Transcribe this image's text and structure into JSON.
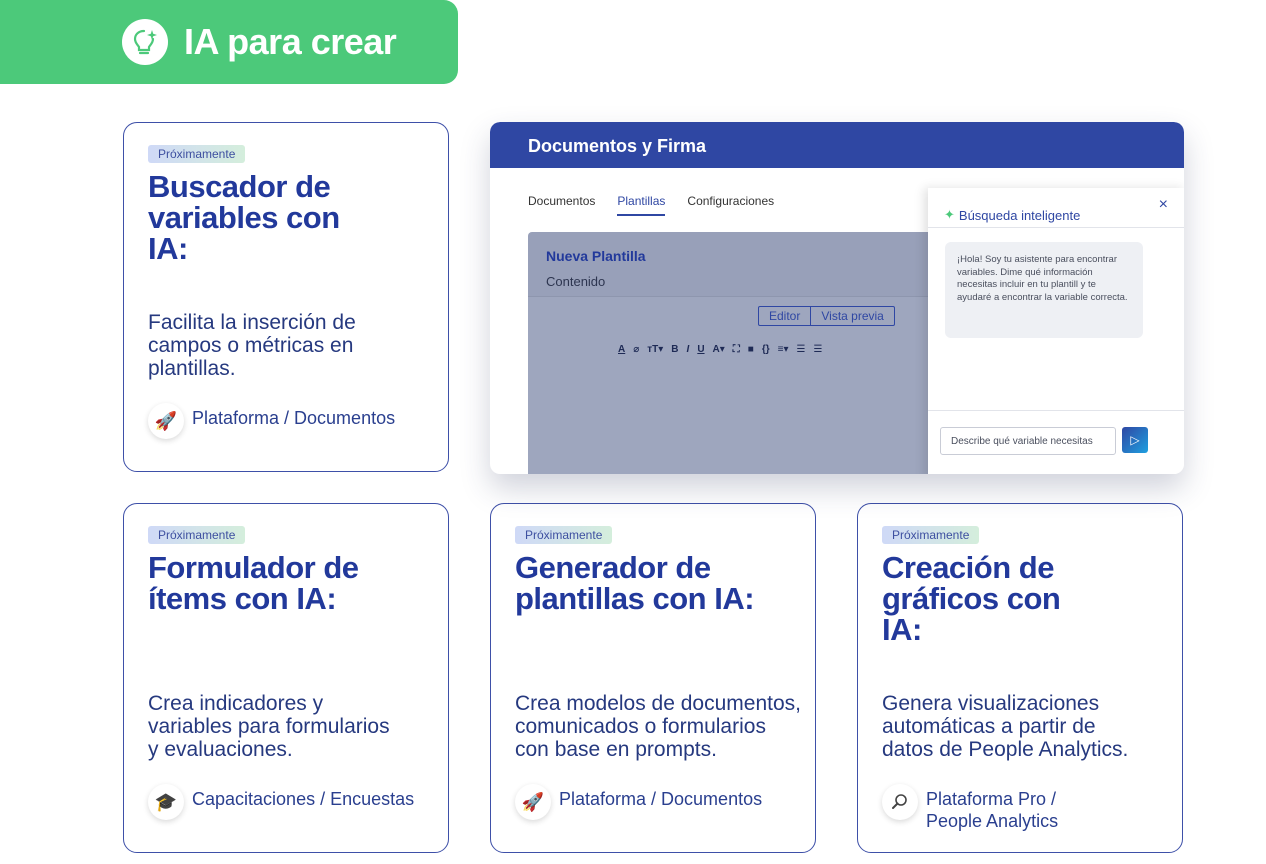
{
  "banner": {
    "title": "IA para crear",
    "icon": "lightbulb-sparkle-icon"
  },
  "badge_label": "Próximamente",
  "cards": [
    {
      "title": "Buscador de variables con IA:",
      "description": "Facilita la inserción de campos o métricas en plantillas.",
      "footer": "Plataforma / Documentos",
      "icon": "rocket-icon"
    },
    {
      "title": "Formulador de ítems con IA:",
      "description": "Crea indicadores y variables para formularios y evaluaciones.",
      "footer": "Capacitaciones / Encuestas",
      "icon": "graduation-cap-icon"
    },
    {
      "title": "Generador de plantillas con IA:",
      "description": "Crea modelos de documentos, comunicados o formularios con base en prompts.",
      "footer": "Plataforma / Documentos",
      "icon": "rocket-icon"
    },
    {
      "title": "Creación de gráficos con IA:",
      "description": "Genera visualizaciones automáticas a partir de datos de People Analytics.",
      "footer_line1": "Plataforma Pro /",
      "footer_line2": "People Analytics",
      "icon": "magnifier-icon"
    }
  ],
  "mock": {
    "header": "Documentos y Firma",
    "tabs": [
      "Documentos",
      "Plantillas",
      "Configuraciones"
    ],
    "active_tab": "Plantillas",
    "editor_title": "Nueva Plantilla",
    "editor_label": "Contenido",
    "mode_editor": "Editor",
    "mode_preview": "Vista previa",
    "chat_title": "Búsqueda inteligente",
    "chat_close": "×",
    "chat_message": "¡Hola! Soy tu asistente para encontrar variables. Dime qué información necesitas incluir en tu plantill y te ayudaré a encontrar la variable correcta.",
    "chat_placeholder": "Describe qué variable necesitas"
  },
  "colors": {
    "banner": "#4cc97a",
    "accent": "#2f47a3",
    "title": "#22399b"
  }
}
